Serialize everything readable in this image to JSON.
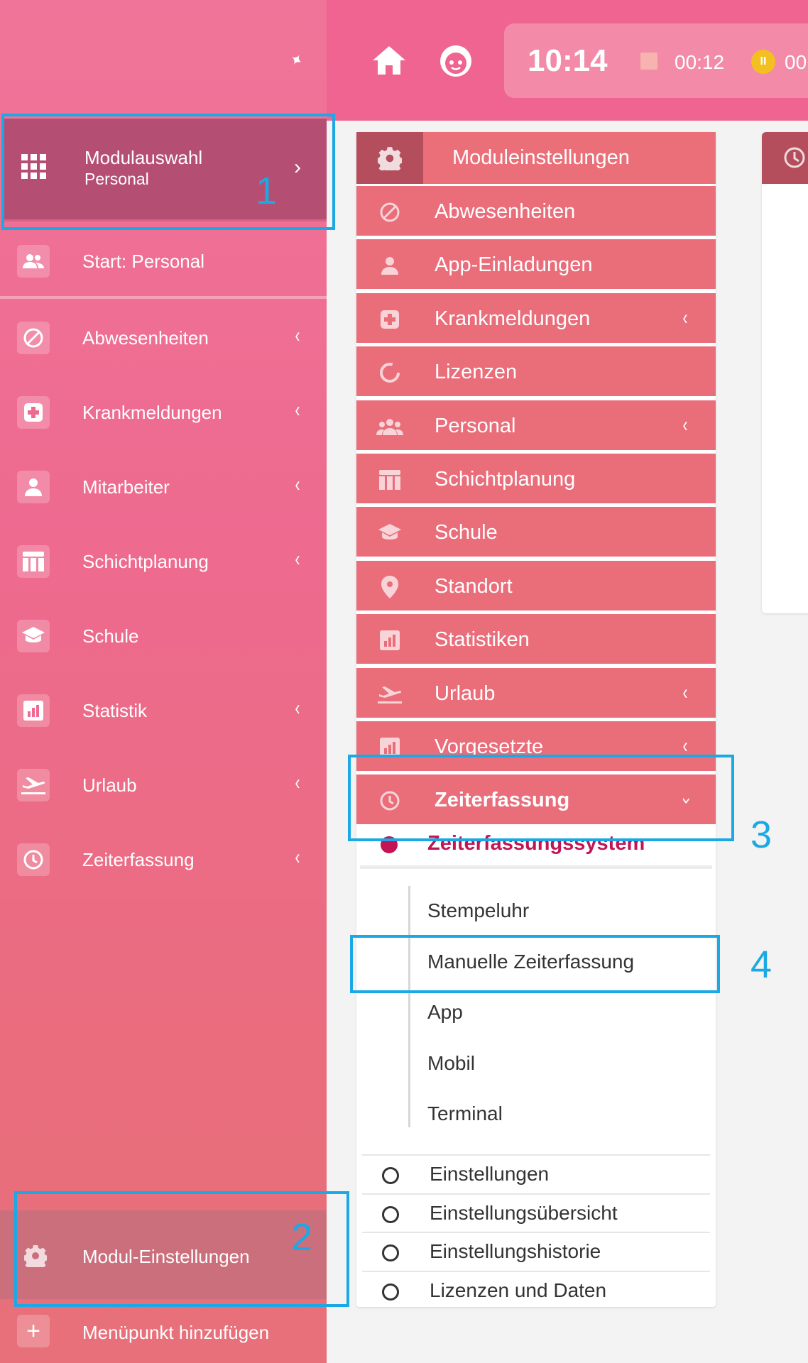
{
  "sidebar": {
    "modulauswahl": {
      "title": "Modulauswahl",
      "subtitle": "Personal"
    },
    "start": "Start: Personal",
    "items": [
      {
        "label": "Abwesenheiten",
        "icon": "block-icon",
        "chevron": "‹"
      },
      {
        "label": "Krankmeldungen",
        "icon": "medical-cross-icon",
        "chevron": "‹"
      },
      {
        "label": "Mitarbeiter",
        "icon": "person-icon",
        "chevron": "‹"
      },
      {
        "label": "Schichtplanung",
        "icon": "table-icon",
        "chevron": "‹"
      },
      {
        "label": "Schule",
        "icon": "school-icon",
        "chevron": ""
      },
      {
        "label": "Statistik",
        "icon": "chart-icon",
        "chevron": "‹"
      },
      {
        "label": "Urlaub",
        "icon": "airplane-icon",
        "chevron": "‹"
      },
      {
        "label": "Zeiterfassung",
        "icon": "clock-icon",
        "chevron": "‹"
      }
    ],
    "modul_einstellungen": "Modul-Einstellungen",
    "add_item": "Menüpunkt hinzufügen"
  },
  "topbar": {
    "time": "10:14",
    "counter_stop": "00:12",
    "counter_pause": "00"
  },
  "panel": {
    "title": "Moduleinstellungen",
    "items": [
      {
        "label": "Abwesenheiten",
        "icon": "block-icon",
        "chevron": ""
      },
      {
        "label": "App-Einladungen",
        "icon": "person-icon",
        "chevron": ""
      },
      {
        "label": "Krankmeldungen",
        "icon": "medical-cross-icon",
        "chevron": "‹"
      },
      {
        "label": "Lizenzen",
        "icon": "license-ring-icon",
        "chevron": ""
      },
      {
        "label": "Personal",
        "icon": "group-icon",
        "chevron": "‹"
      },
      {
        "label": "Schichtplanung",
        "icon": "table-icon",
        "chevron": ""
      },
      {
        "label": "Schule",
        "icon": "school-icon",
        "chevron": ""
      },
      {
        "label": "Standort",
        "icon": "location-pin-icon",
        "chevron": ""
      },
      {
        "label": "Statistiken",
        "icon": "chart-icon",
        "chevron": ""
      },
      {
        "label": "Urlaub",
        "icon": "airplane-icon",
        "chevron": "‹"
      },
      {
        "label": "Vorgesetzte",
        "icon": "chart-icon",
        "chevron": "‹"
      },
      {
        "label": "Zeiterfassung",
        "icon": "clock-icon",
        "chevron": "›"
      }
    ],
    "system_label": "Zeiterfassungssystem",
    "sub_items": [
      "Stempeluhr",
      "Manuelle Zeiterfassung",
      "App",
      "Mobil",
      "Terminal"
    ],
    "options": [
      "Einstellungen",
      "Einstellungsübersicht",
      "Einstellungshistorie",
      "Lizenzen und Daten"
    ]
  },
  "annotations": [
    "1",
    "2",
    "3",
    "4"
  ],
  "colors": {
    "sidebar": "#ee6a8f",
    "topbar": "#ef6491",
    "panel_item": "#ea6d7a",
    "accent_dark": "#b44d5c",
    "active_system": "#c21456",
    "annotation": "#1aa9e5"
  }
}
